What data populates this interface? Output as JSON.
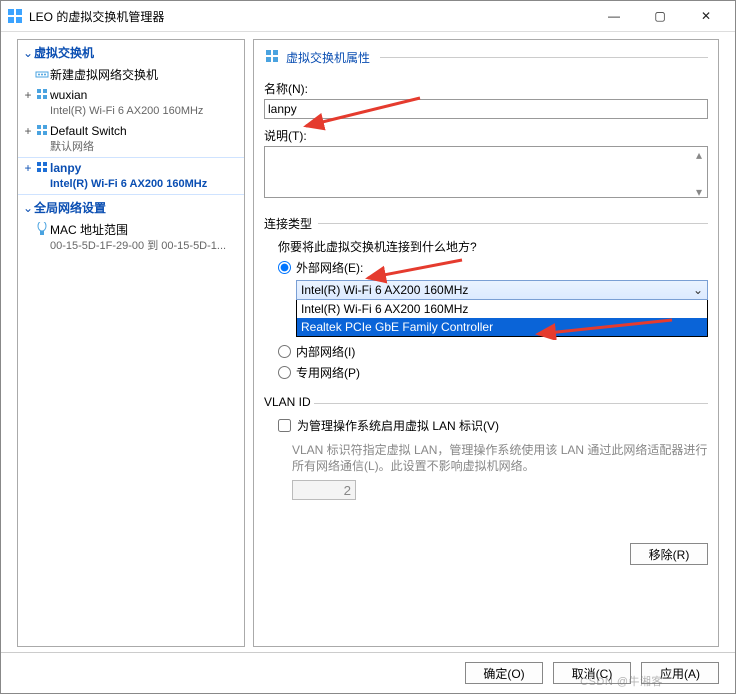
{
  "window": {
    "title": "LEO 的虚拟交换机管理器",
    "buttons": {
      "min": "—",
      "max": "▢",
      "close": "✕"
    }
  },
  "left": {
    "sec1": "虚拟交换机",
    "newItem": "新建虚拟网络交换机",
    "items": [
      {
        "name": "wuxian",
        "sub": "Intel(R) Wi-Fi 6 AX200 160MHz"
      },
      {
        "name": "Default Switch",
        "sub": "默认网络"
      },
      {
        "name": "lanpy",
        "sub": "Intel(R) Wi-Fi 6 AX200 160MHz"
      }
    ],
    "sec2": "全局网络设置",
    "mac": {
      "name": "MAC 地址范围",
      "sub": "00-15-5D-1F-29-00 到 00-15-5D-1..."
    }
  },
  "right": {
    "header": "虚拟交换机属性",
    "nameLabel": "名称(N):",
    "nameValue": "lanpy",
    "descLabel": "说明(T):",
    "descValue": "",
    "conn": {
      "title": "连接类型",
      "question": "你要将此虚拟交换机连接到什么地方?",
      "r1": "外部网络(E):",
      "comboValue": "Intel(R) Wi-Fi 6 AX200 160MHz",
      "opt1": "Intel(R) Wi-Fi 6 AX200 160MHz",
      "opt2": "Realtek PCIe GbE Family Controller",
      "r2": "内部网络(I)",
      "r3": "专用网络(P)"
    },
    "vlan": {
      "title": "VLAN ID",
      "chk": "为管理操作系统启用虚拟 LAN 标识(V)",
      "hint": "VLAN 标识符指定虚拟 LAN，管理操作系统使用该 LAN 通过此网络适配器进行所有网络通信(L)。此设置不影响虚拟机网络。",
      "value": "2"
    },
    "remove": "移除(R)"
  },
  "footer": {
    "ok": "确定(O)",
    "cancel": "取消(C)",
    "apply": "应用(A)"
  },
  "watermark": "CSDN @牛湘客"
}
